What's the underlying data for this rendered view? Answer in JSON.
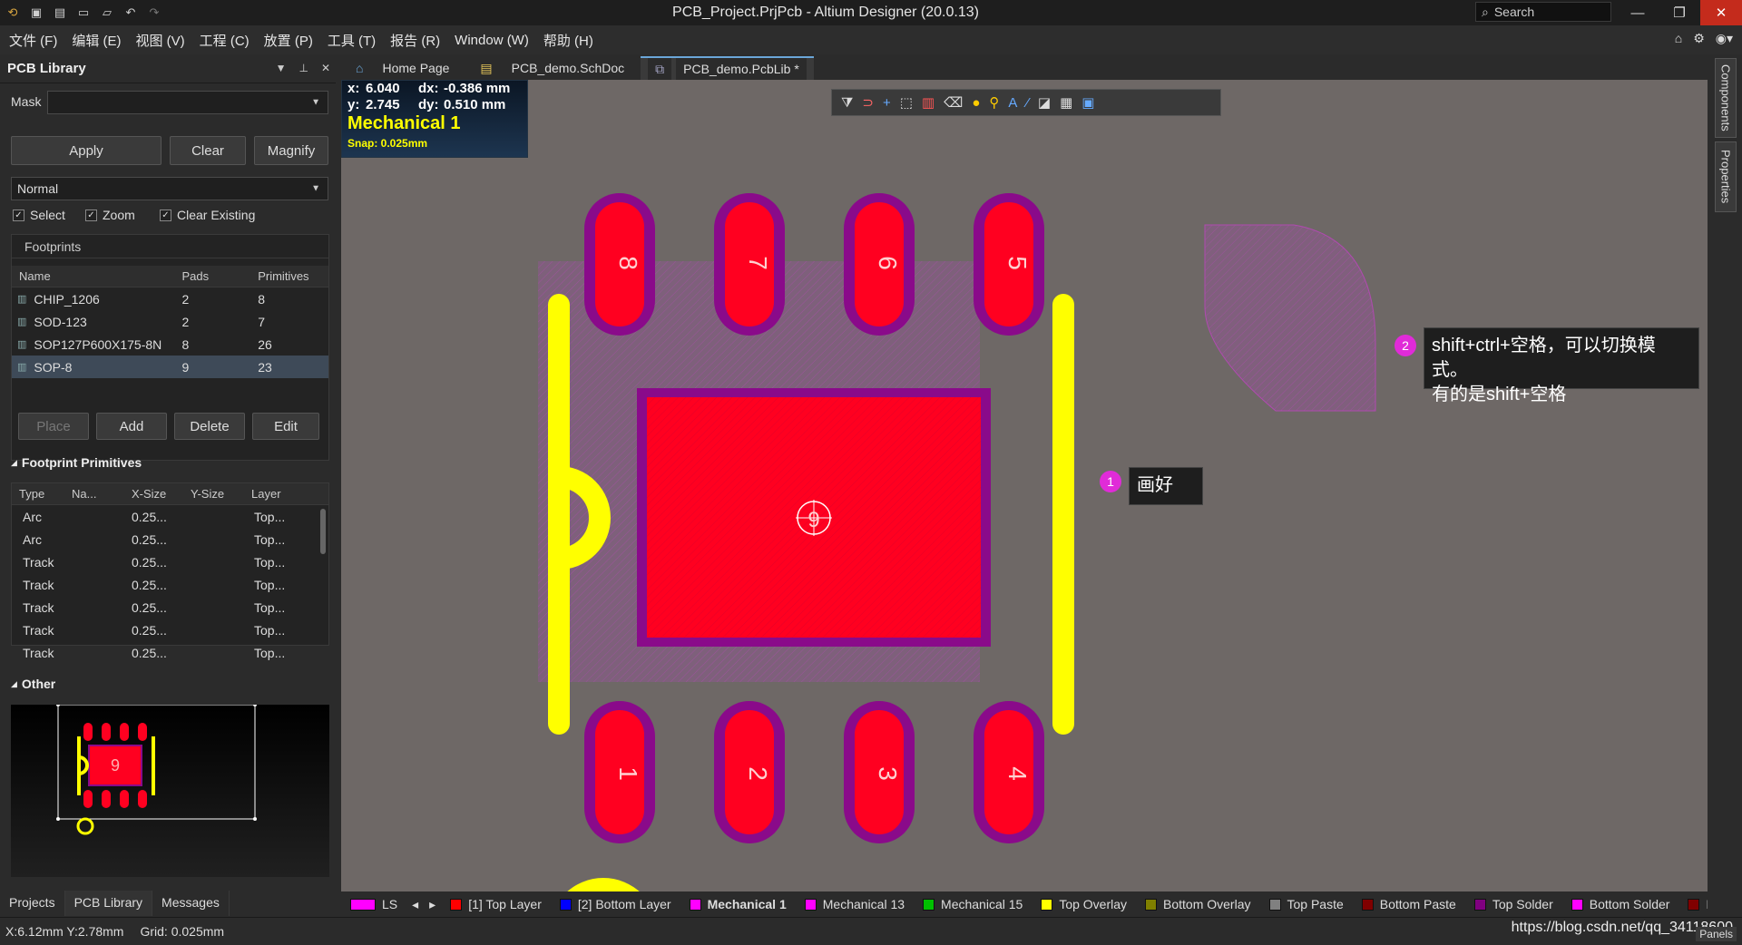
{
  "window": {
    "title": "PCB_Project.PrjPcb - Altium Designer (20.0.13)",
    "search_label": "Search",
    "min_glyph": "—",
    "max_glyph": "❐",
    "close_glyph": "✕"
  },
  "menu": [
    "文件 (F)",
    "编辑 (E)",
    "视图 (V)",
    "工程 (C)",
    "放置 (P)",
    "工具 (T)",
    "报告 (R)",
    "Window (W)",
    "帮助 (H)"
  ],
  "panel": {
    "title": "PCB Library",
    "mask_label": "Mask",
    "mask_value": "",
    "apply": "Apply",
    "clear": "Clear",
    "magnify": "Magnify",
    "mode": "Normal",
    "checks": [
      {
        "label": "Select",
        "checked": true
      },
      {
        "label": "Zoom",
        "checked": true
      },
      {
        "label": "Clear Existing",
        "checked": true
      }
    ],
    "footprints_label": "Footprints",
    "fp_headers": [
      "Name",
      "Pads",
      "Primitives"
    ],
    "footprints": [
      {
        "name": "CHIP_1206",
        "pads": "2",
        "primitives": "8"
      },
      {
        "name": "SOD-123",
        "pads": "2",
        "primitives": "7"
      },
      {
        "name": "SOP127P600X175-8N",
        "pads": "8",
        "primitives": "26"
      },
      {
        "name": "SOP-8",
        "pads": "9",
        "primitives": "23"
      }
    ],
    "place": "Place",
    "add": "Add",
    "delete": "Delete",
    "edit": "Edit",
    "primitives_label": "Footprint Primitives",
    "prim_headers": [
      "Type",
      "Na...",
      "X-Size",
      "Y-Size",
      "Layer"
    ],
    "primitives": [
      {
        "type": "Arc",
        "x": "0.25...",
        "layer": "Top..."
      },
      {
        "type": "Arc",
        "x": "0.25...",
        "layer": "Top..."
      },
      {
        "type": "Track",
        "x": "0.25...",
        "layer": "Top..."
      },
      {
        "type": "Track",
        "x": "0.25...",
        "layer": "Top..."
      },
      {
        "type": "Track",
        "x": "0.25...",
        "layer": "Top..."
      },
      {
        "type": "Track",
        "x": "0.25...",
        "layer": "Top..."
      },
      {
        "type": "Track",
        "x": "0.25...",
        "layer": "Top..."
      }
    ],
    "other_label": "Other",
    "preview_pad": "9"
  },
  "bottom_tabs": [
    "Projects",
    "PCB Library",
    "Messages"
  ],
  "doc_tabs": [
    "Home Page",
    "PCB_demo.SchDoc",
    "PCB_demo.PcbLib *"
  ],
  "coord": {
    "x_label": "x:",
    "x": "6.040",
    "dx_label": "dx:",
    "dx": "-0.386 mm",
    "y_label": "y:",
    "y": "2.745",
    "dy_label": "dy:",
    "dy": "0.510 mm",
    "layer": "Mechanical 1",
    "snap": "Snap: 0.025mm"
  },
  "pads": [
    "8",
    "7",
    "6",
    "5",
    "1",
    "2",
    "3",
    "4"
  ],
  "center_pad": "9",
  "callouts": [
    {
      "badge": "1",
      "text": "画好"
    },
    {
      "badge": "2",
      "line1": "shift+ctrl+空格，可以切换模式。",
      "line2": "有的是shift+空格"
    }
  ],
  "right_tabs": [
    "Components",
    "Properties"
  ],
  "layers": {
    "ls": "LS",
    "items": [
      {
        "label": "[1] Top Layer",
        "color": "#ff0000"
      },
      {
        "label": "[2] Bottom Layer",
        "color": "#0000ff"
      },
      {
        "label": "Mechanical 1",
        "color": "#ff00ff",
        "active": true
      },
      {
        "label": "Mechanical 13",
        "color": "#ff00ff"
      },
      {
        "label": "Mechanical 15",
        "color": "#00c000"
      },
      {
        "label": "Top Overlay",
        "color": "#ffff00"
      },
      {
        "label": "Bottom Overlay",
        "color": "#808000"
      },
      {
        "label": "Top Paste",
        "color": "#808080"
      },
      {
        "label": "Bottom Paste",
        "color": "#800000"
      },
      {
        "label": "Top Solder",
        "color": "#800080"
      },
      {
        "label": "Bottom Solder",
        "color": "#ff00ff"
      },
      {
        "label": "D",
        "color": "#800000"
      }
    ]
  },
  "status": {
    "pos": "X:6.12mm Y:2.78mm",
    "grid": "Grid: 0.025mm",
    "watermark": "https://blog.csdn.net/qq_34118600",
    "panels": "Panels"
  },
  "colors": {
    "pad": "#ff0020",
    "solder": "#8a0a8a",
    "overlay": "#ffff00",
    "canvas": "#6e6866"
  }
}
